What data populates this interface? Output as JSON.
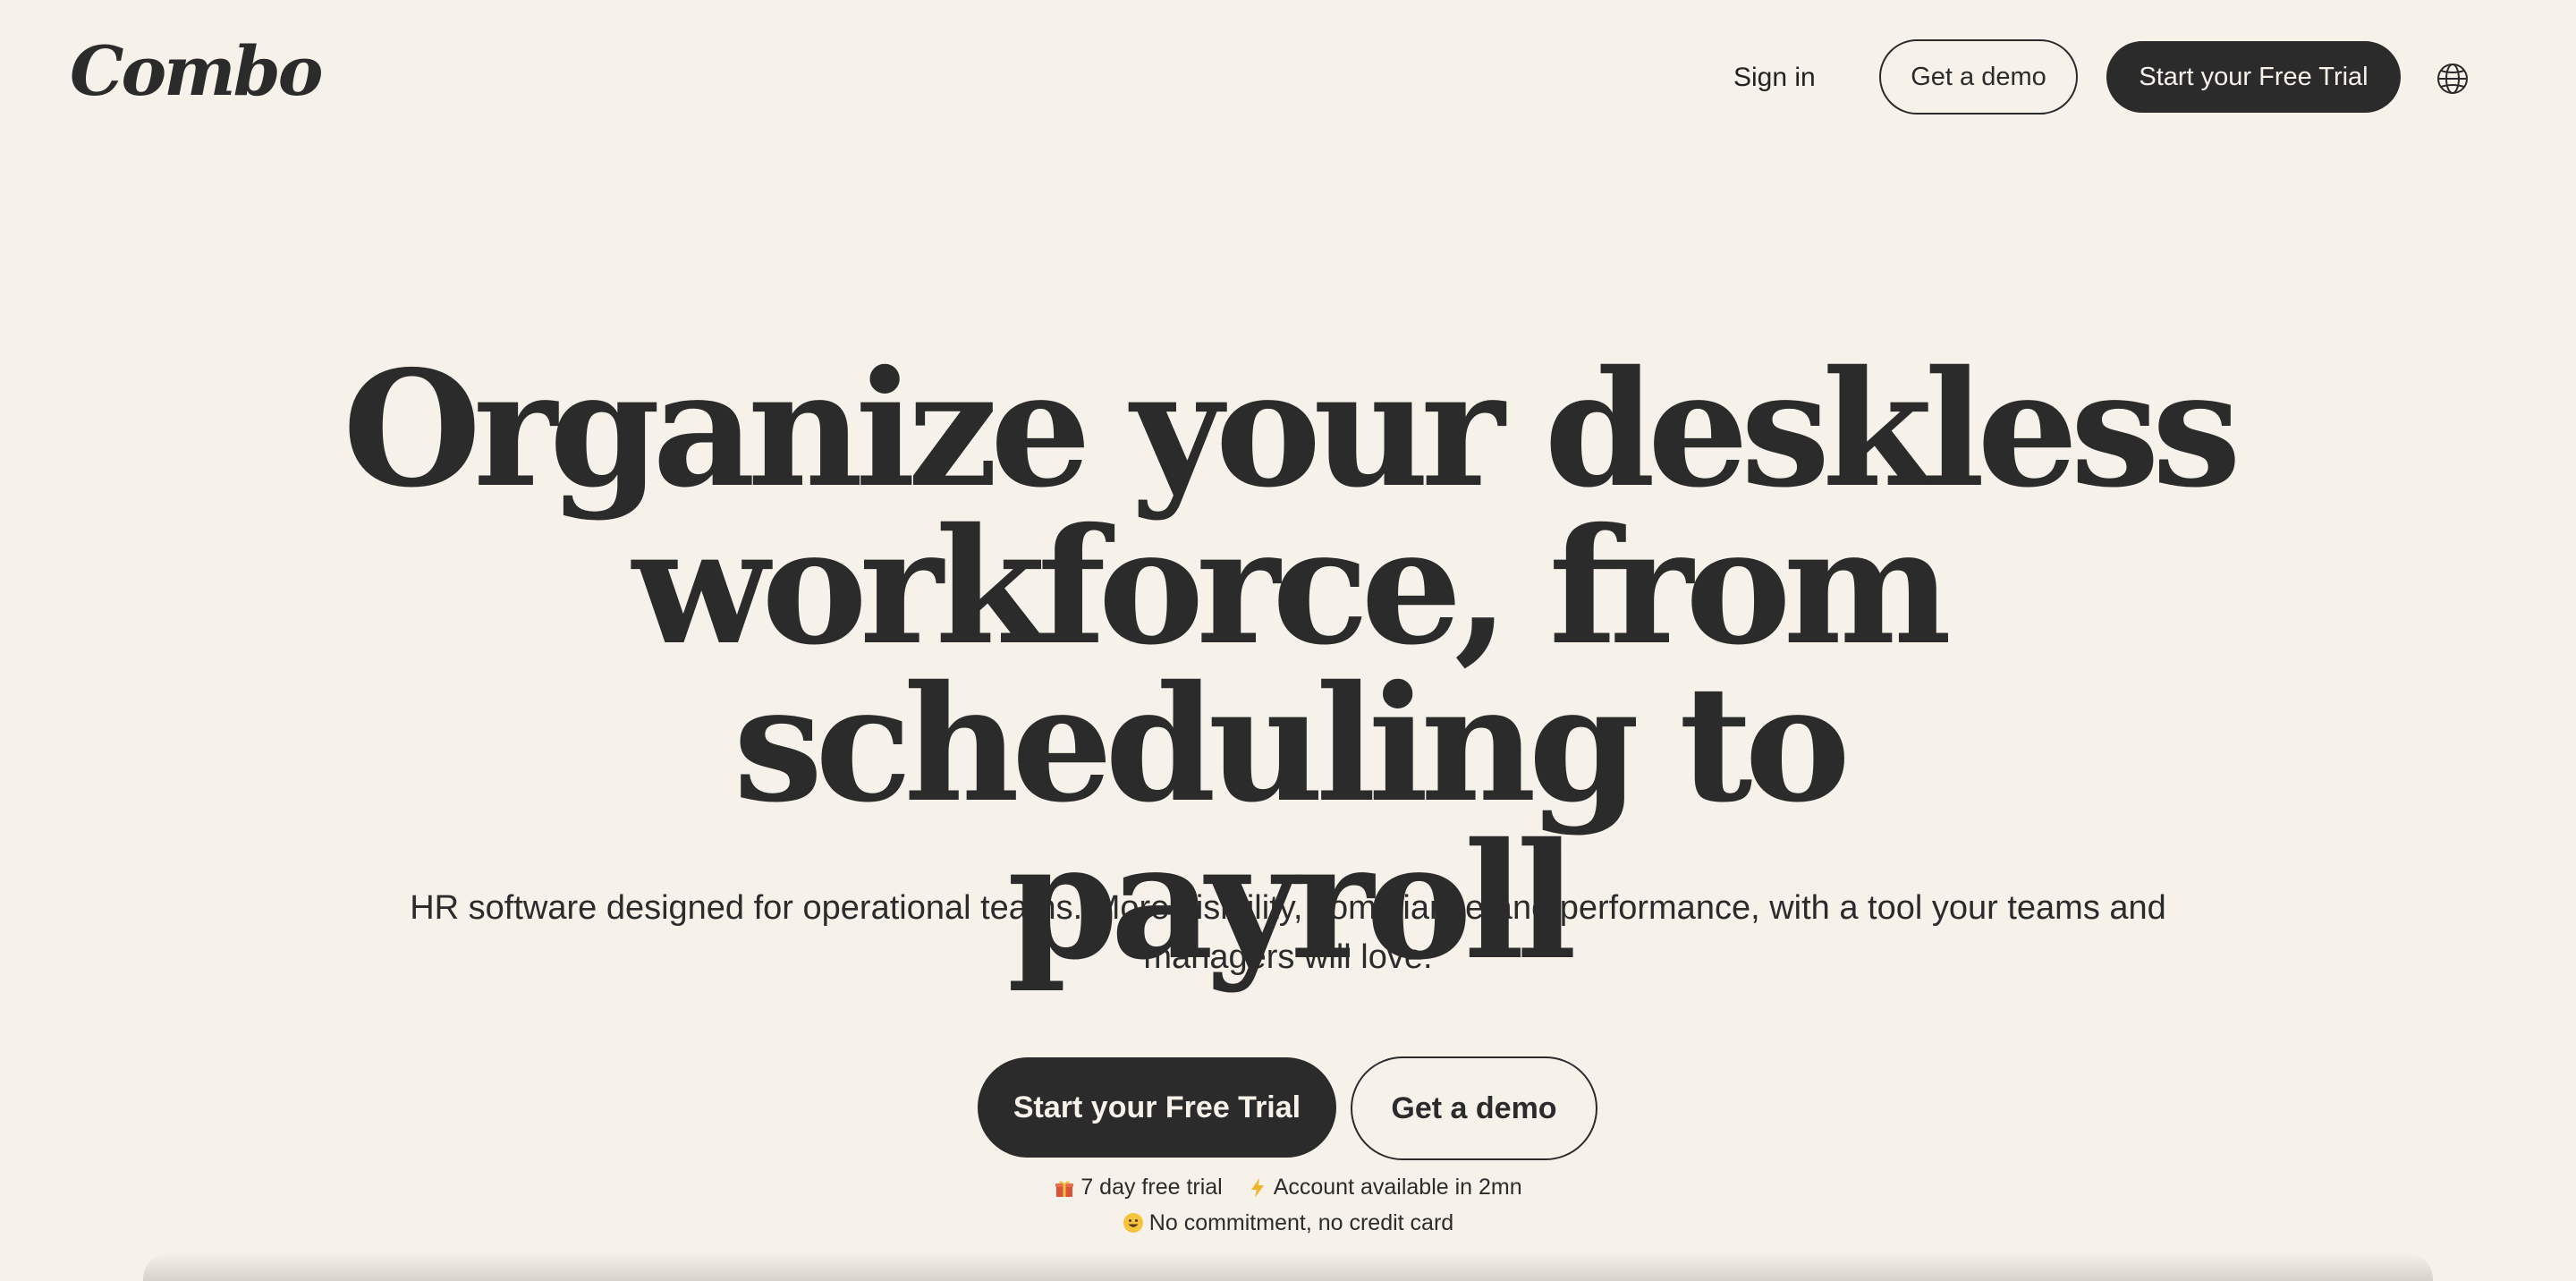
{
  "header": {
    "logo_text": "Combo",
    "signin_label": "Sign in",
    "demo_label": "Get a demo",
    "trial_label": "Start your Free Trial",
    "language_icon": "globe-icon"
  },
  "hero": {
    "headline_line1": "Organize your deskless",
    "headline_line2": "workforce, from scheduling to",
    "headline_line3": "payroll",
    "subhead_line1": "HR software designed for operational teams. More visibility, compliance and performance, with a tool your teams and",
    "subhead_line2": "managers will love.",
    "cta_trial_label": "Start your Free Trial",
    "cta_demo_label": "Get a demo",
    "perks": {
      "trial_days": "7 day free trial",
      "account_ready": "Account available in 2mn",
      "no_commitment": "No commitment, no credit card"
    }
  },
  "colors": {
    "background": "#f6f2ea",
    "ink": "#2b2b2b"
  }
}
